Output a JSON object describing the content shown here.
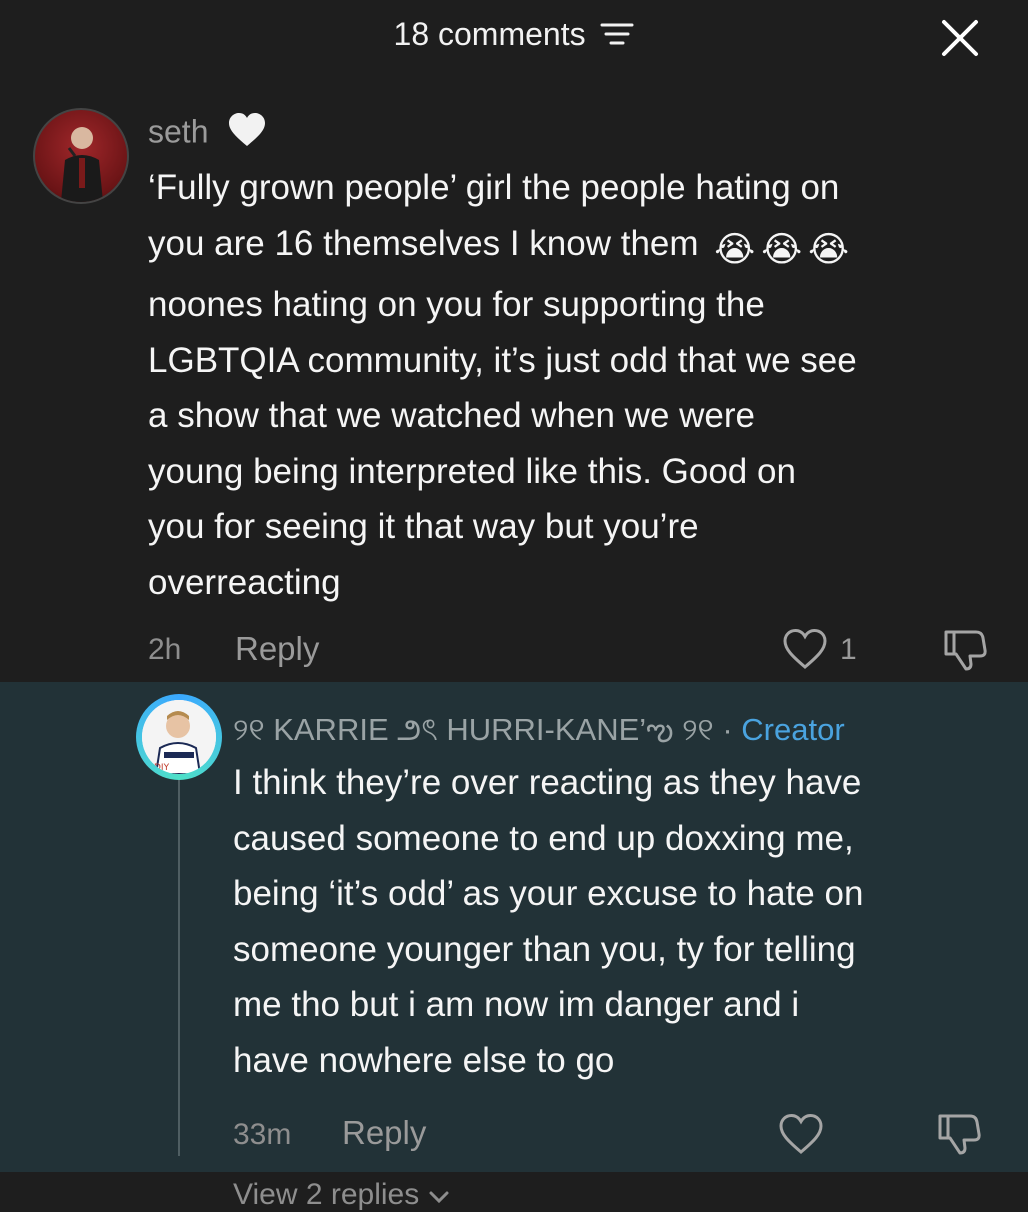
{
  "header": {
    "title": "18 comments",
    "sort_icon": "sort-lines-icon",
    "close_icon": "close-icon"
  },
  "comments": [
    {
      "username": "seth",
      "badge_icon": "white-heart-icon",
      "text_lines": [
        "‘Fully grown people’ girl the people hating on",
        "you are 16 themselves I know them",
        "noones hating on you for supporting the",
        "LGBTQIA community, it’s just odd that we see",
        "a show that we watched when we were",
        "young being interpreted like this. Good on",
        "you for seeing it that way but you’re",
        "overreacting"
      ],
      "emoji": [
        "😭",
        "😭",
        "😭"
      ],
      "time": "2h",
      "reply_label": "Reply",
      "like_count": "1"
    }
  ],
  "reply": {
    "username": "୨୧ KARRIE ౨ৎ HURRI-KANE’ఌ ୨୧",
    "separator": "·",
    "creator_label": "Creator",
    "text_lines": [
      "I think they’re over reacting as they have",
      "caused someone to end up doxxing me,",
      "being ‘it’s odd’ as your excuse to hate on",
      "someone younger than you, ty for telling",
      "me tho but i am now im danger and i",
      "have nowhere else to go"
    ],
    "time": "33m",
    "reply_label": "Reply",
    "view_replies": "View 2 replies"
  },
  "colors": {
    "background": "#1e1e1e",
    "reply_background": "#223237",
    "creator": "#4aa3df"
  }
}
